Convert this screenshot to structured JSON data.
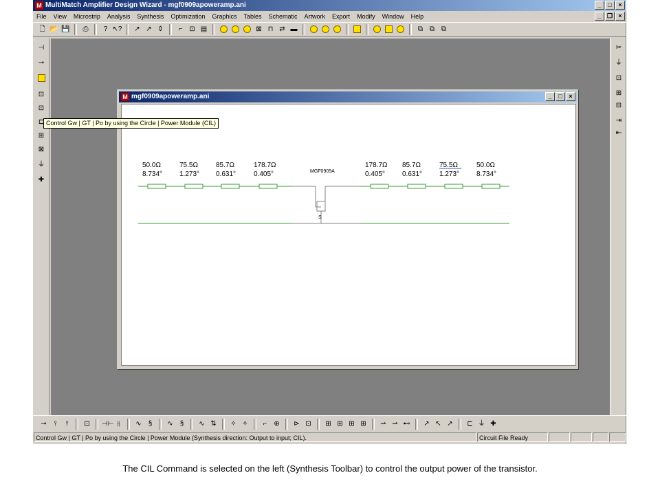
{
  "app": {
    "title": "MultiMatch Amplifier Design Wizard - mgf0909apoweramp.ani",
    "icon_letter": "M",
    "window_buttons": [
      "_",
      "□",
      "×"
    ],
    "menu": [
      "File",
      "View",
      "Microstrip",
      "Analysis",
      "Synthesis",
      "Optimization",
      "Graphics",
      "Tables",
      "Schematic",
      "Artwork",
      "Export",
      "Modify",
      "Window",
      "Help"
    ],
    "menu_window_buttons": [
      "_",
      "❐",
      "×"
    ]
  },
  "toolbar_icons": [
    "new-file-icon",
    "open-folder-icon",
    "save-disk-icon",
    "print-icon",
    "help-icon",
    "context-help-icon",
    "tool-a-icon",
    "tool-b-icon",
    "tool-c-icon",
    "stub-icon",
    "component-icon",
    "box-icon",
    "circle-icon",
    "circle-f-icon",
    "circle-dot-icon",
    "x-box-icon",
    "port-icon",
    "swap-icon",
    "line-icon",
    "y-circle-icon",
    "s-circle-icon",
    "dot-circle-icon",
    "pulse-icon",
    "circle-plain-icon",
    "square-plain-icon",
    "minus-circle-icon",
    "layer-a-icon",
    "layer-b-icon",
    "layer-c-icon"
  ],
  "tooltip": "Control Gw | GT | Po by using the Circle | Power Module  (CIL)",
  "child_window": {
    "title": "mgf0909apoweramp.ani",
    "buttons": [
      "_",
      "□",
      "×"
    ]
  },
  "schematic": {
    "transistor_label": "MGF0909A",
    "source_label": "S",
    "left_elements": [
      {
        "impedance": "50.0Ω",
        "angle": "8.734°"
      },
      {
        "impedance": "75.5Ω",
        "angle": "1.273°"
      },
      {
        "impedance": "85.7Ω",
        "angle": "0.631°"
      },
      {
        "impedance": "178.7Ω",
        "angle": "0.405°"
      }
    ],
    "right_elements": [
      {
        "impedance": "178.7Ω",
        "angle": "0.405°"
      },
      {
        "impedance": "85.7Ω",
        "angle": "0.631°"
      },
      {
        "impedance": "75.5Ω",
        "angle": "1.273°"
      },
      {
        "impedance": "50.0Ω",
        "angle": "8.734°"
      }
    ],
    "line_color": "#3a9a3a"
  },
  "status": {
    "message": "Control Gw | GT |  Po by using the Circle | Power Module  (Synthesis direction: Output to input; CIL).",
    "state": "Circuit File Ready"
  },
  "caption": "The CIL Command is selected on the left (Synthesis Toolbar) to control the output power of the transistor."
}
